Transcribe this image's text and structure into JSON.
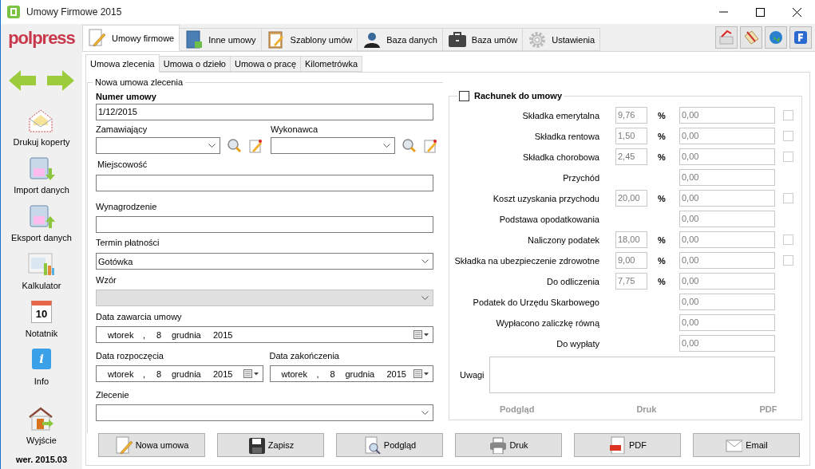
{
  "window": {
    "title": "Umowy Firmowe 2015"
  },
  "logo": "polpress",
  "main_tabs": [
    {
      "label": "Umowy firmowe",
      "selected": true
    },
    {
      "label": "Inne umowy",
      "selected": false
    },
    {
      "label": "Szablony umów",
      "selected": false
    },
    {
      "label": "Baza danych",
      "selected": false
    },
    {
      "label": "Baza umów",
      "selected": false
    },
    {
      "label": "Ustawienia",
      "selected": false
    }
  ],
  "sidebar": {
    "items": [
      {
        "label": "Drukuj koperty"
      },
      {
        "label": "Import danych"
      },
      {
        "label": "Eksport danych"
      },
      {
        "label": "Kalkulator"
      },
      {
        "label": "Notatnik",
        "icon_text": "10"
      },
      {
        "label": "Info",
        "icon_text": "i"
      },
      {
        "label": "Wyjście"
      }
    ],
    "version": "wer. 2015.03"
  },
  "sub_tabs": [
    {
      "label": "Umowa zlecenia",
      "selected": true
    },
    {
      "label": "Umowa o dzieło",
      "selected": false
    },
    {
      "label": "Umowa o pracę",
      "selected": false
    },
    {
      "label": "Kilometrówka",
      "selected": false
    }
  ],
  "form": {
    "title": "Nowa umowa zlecenia",
    "numer_umowy": {
      "label": "Numer umowy",
      "value": "1/12/2015"
    },
    "zamawiajacy": {
      "label": "Zamawiający"
    },
    "wykonawca": {
      "label": "Wykonawca"
    },
    "miejscowosc": {
      "label": "Miejscowość"
    },
    "wynagrodzenie": {
      "label": "Wynagrodzenie"
    },
    "termin_platnosci": {
      "label": "Termin płatności",
      "value": "Gotówka"
    },
    "wzor": {
      "label": "Wzór",
      "disabled": true
    },
    "data_zawarcia": {
      "label": "Data zawarcia umowy",
      "parts": [
        "wtorek",
        ",",
        "8",
        "grudnia",
        "2015"
      ]
    },
    "data_rozpoczecia": {
      "label": "Data rozpoczęcia",
      "parts": [
        "wtorek",
        ",",
        "8",
        "grudnia",
        "2015"
      ]
    },
    "data_zakonczenia": {
      "label": "Data zakończenia",
      "parts": [
        "wtorek",
        ",",
        "8",
        "grudnia",
        "2015"
      ]
    },
    "zlecenie": {
      "label": "Zlecenie"
    }
  },
  "rachunek": {
    "title": "Rachunek do umowy",
    "checked": false,
    "rows": [
      {
        "label": "Składka emerytalna",
        "percent": "9,76",
        "sign": "%",
        "value": "0,00",
        "disabled": true,
        "checked": false
      },
      {
        "label": "Składka rentowa",
        "percent": "1,50",
        "sign": "%",
        "value": "0,00",
        "disabled": true,
        "checked": false
      },
      {
        "label": "Składka chorobowa",
        "percent": "2,45",
        "sign": "%",
        "value": "0,00",
        "disabled": true,
        "checked": false
      },
      {
        "label": "Przychód",
        "value": "0,00",
        "disabled": true
      },
      {
        "label": "Koszt uzyskania przychodu",
        "percent": "20,00",
        "sign": "%",
        "value": "0,00",
        "disabled": true,
        "checked": false
      },
      {
        "label": "Podstawa opodatkowania",
        "value": "0,00",
        "disabled": true
      },
      {
        "label": "Naliczony podatek",
        "percent": "18,00",
        "sign": "%",
        "value": "0,00",
        "disabled": true,
        "checked": false
      },
      {
        "label": "Składka na ubezpieczenie zdrowotne",
        "percent": "9,00",
        "sign": "%",
        "value": "0,00",
        "disabled": true,
        "checked": false
      },
      {
        "label": "Do odliczenia",
        "percent": "7,75",
        "sign": "%",
        "value": "0,00",
        "disabled": true
      },
      {
        "label": "Podatek do Urzędu Skarbowego",
        "value": "0,00",
        "disabled": true
      },
      {
        "label": "Wypłacono zaliczkę równą",
        "value": "0,00",
        "disabled": true
      },
      {
        "label": "Do wypłaty",
        "value": "0,00",
        "disabled": true
      }
    ],
    "uwagi_label": "Uwagi",
    "actions": [
      {
        "label": "Podgląd",
        "disabled": true
      },
      {
        "label": "Druk",
        "disabled": true
      },
      {
        "label": "PDF",
        "disabled": true
      }
    ]
  },
  "buttons": [
    {
      "label": "Nowa umowa"
    },
    {
      "label": "Zapisz"
    },
    {
      "label": "Podgląd"
    },
    {
      "label": "Druk"
    },
    {
      "label": "PDF"
    },
    {
      "label": "Email"
    }
  ]
}
